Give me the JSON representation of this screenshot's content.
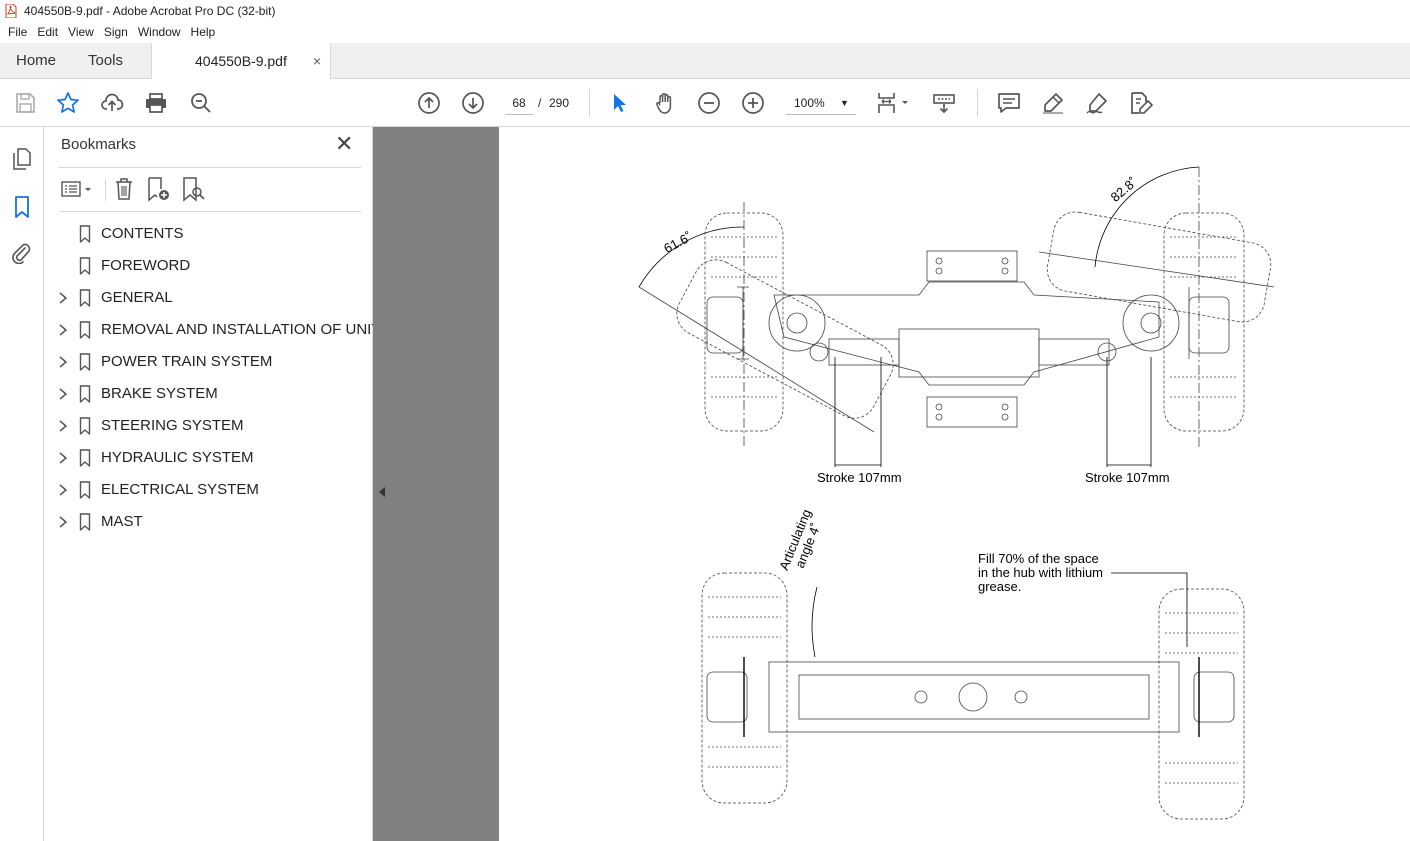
{
  "window": {
    "title": "404550B-9.pdf - Adobe Acrobat Pro DC (32-bit)"
  },
  "menu": [
    "File",
    "Edit",
    "View",
    "Sign",
    "Window",
    "Help"
  ],
  "tabs": {
    "home": "Home",
    "tools": "Tools",
    "document": "404550B-9.pdf",
    "close": "×"
  },
  "toolbar": {
    "page_current": "68",
    "page_sep": "/",
    "page_total": "290",
    "zoom": "100%"
  },
  "bookmarks": {
    "title": "Bookmarks",
    "close": "✕",
    "items": [
      {
        "label": "CONTENTS",
        "expandable": false
      },
      {
        "label": "FOREWORD",
        "expandable": false
      },
      {
        "label": "GENERAL",
        "expandable": true
      },
      {
        "label": "REMOVAL AND INSTALLATION OF UNIT",
        "expandable": true
      },
      {
        "label": "POWER TRAIN SYSTEM",
        "expandable": true
      },
      {
        "label": "BRAKE SYSTEM",
        "expandable": true
      },
      {
        "label": "STEERING SYSTEM",
        "expandable": true
      },
      {
        "label": "HYDRAULIC SYSTEM",
        "expandable": true
      },
      {
        "label": "ELECTRICAL SYSTEM",
        "expandable": true
      },
      {
        "label": "MAST",
        "expandable": true
      }
    ]
  },
  "drawing": {
    "angle_left": "61.6˚",
    "angle_right": "82.8˚",
    "stroke_left": "Stroke 107mm",
    "stroke_right": "Stroke 107mm",
    "articulating_1": "Articulating",
    "articulating_2": "angle 4˚",
    "note_1": "Fill 70% of the space",
    "note_2": "in the hub with lithium",
    "note_3": "grease."
  },
  "colors": {
    "accent": "#1473e6",
    "gutter": "#808080",
    "pdf_red": "#d9342b"
  }
}
